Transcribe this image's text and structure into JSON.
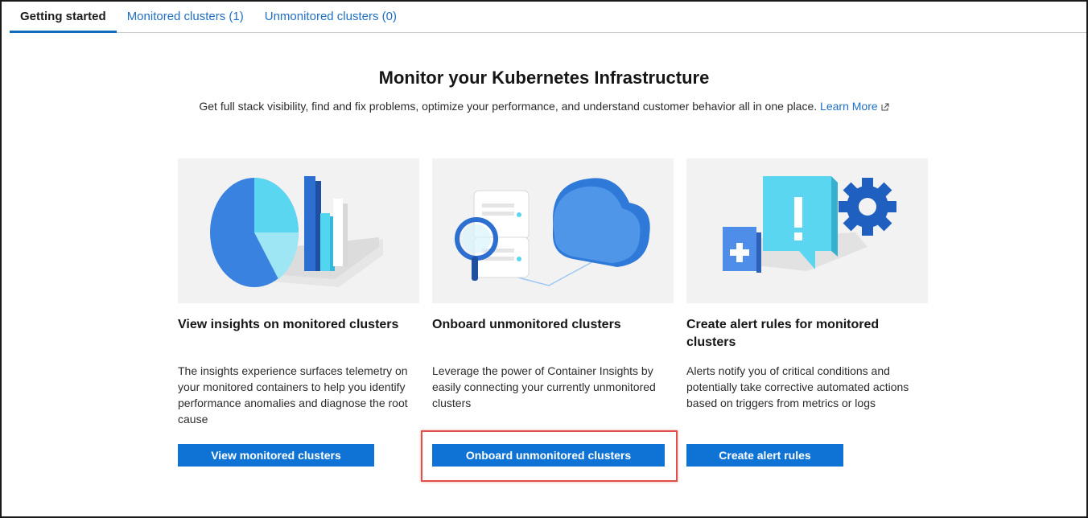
{
  "tabs": [
    {
      "label": "Getting started",
      "active": true
    },
    {
      "label": "Monitored clusters (1)",
      "active": false
    },
    {
      "label": "Unmonitored clusters (0)",
      "active": false
    }
  ],
  "hero": {
    "title": "Monitor your Kubernetes Infrastructure",
    "subtitle": "Get full stack visibility, find and fix problems, optimize your performance, and understand customer behavior all in one place.",
    "learn_more": "Learn More"
  },
  "cards": [
    {
      "title": "View insights on monitored clusters",
      "description": "The insights experience surfaces telemetry on your monitored containers to help you identify performance anomalies and diagnose the root cause",
      "button": "View monitored clusters"
    },
    {
      "title": "Onboard unmonitored clusters",
      "description": "Leverage the power of Container Insights by easily connecting your currently unmonitored clusters",
      "button": "Onboard unmonitored clusters"
    },
    {
      "title": "Create alert rules for monitored clusters",
      "description": "Alerts notify you of critical conditions and potentially take corrective automated actions based on triggers from metrics or logs",
      "button": "Create alert rules"
    }
  ],
  "icons": {
    "external_link": "external-link-icon",
    "card_images": [
      "pie-bar-chart-illustration",
      "server-cloud-magnifier-illustration",
      "alert-plus-gear-illustration"
    ]
  },
  "colors": {
    "accent": "#0f73d6",
    "link": "#1f6fc5",
    "highlight": "#e0504a"
  }
}
